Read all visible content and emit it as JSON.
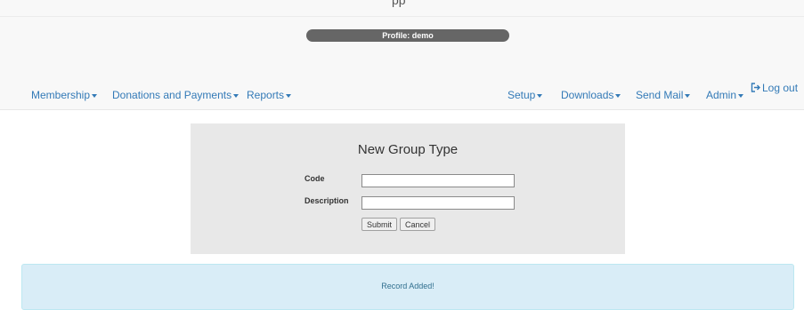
{
  "header": {
    "clipped_title": "pp",
    "profile_label": "Profile: demo"
  },
  "nav": {
    "left": [
      {
        "label": "Membership"
      },
      {
        "label": "Donations and Payments"
      },
      {
        "label": "Reports"
      }
    ],
    "right": [
      {
        "label": "Setup"
      },
      {
        "label": "Downloads"
      },
      {
        "label": "Send Mail"
      },
      {
        "label": "Admin"
      }
    ],
    "logout_label": "Log out"
  },
  "form": {
    "title": "New Group Type",
    "code_label": "Code",
    "code_value": "",
    "description_label": "Description",
    "description_value": "",
    "submit_label": "Submit",
    "cancel_label": "Cancel"
  },
  "alert": {
    "message": "Record Added!"
  },
  "colors": {
    "link": "#337ab7",
    "pill": "#666666",
    "panel": "#e8e8e8",
    "alert_bg": "#d9edf7",
    "alert_text": "#31708f"
  }
}
